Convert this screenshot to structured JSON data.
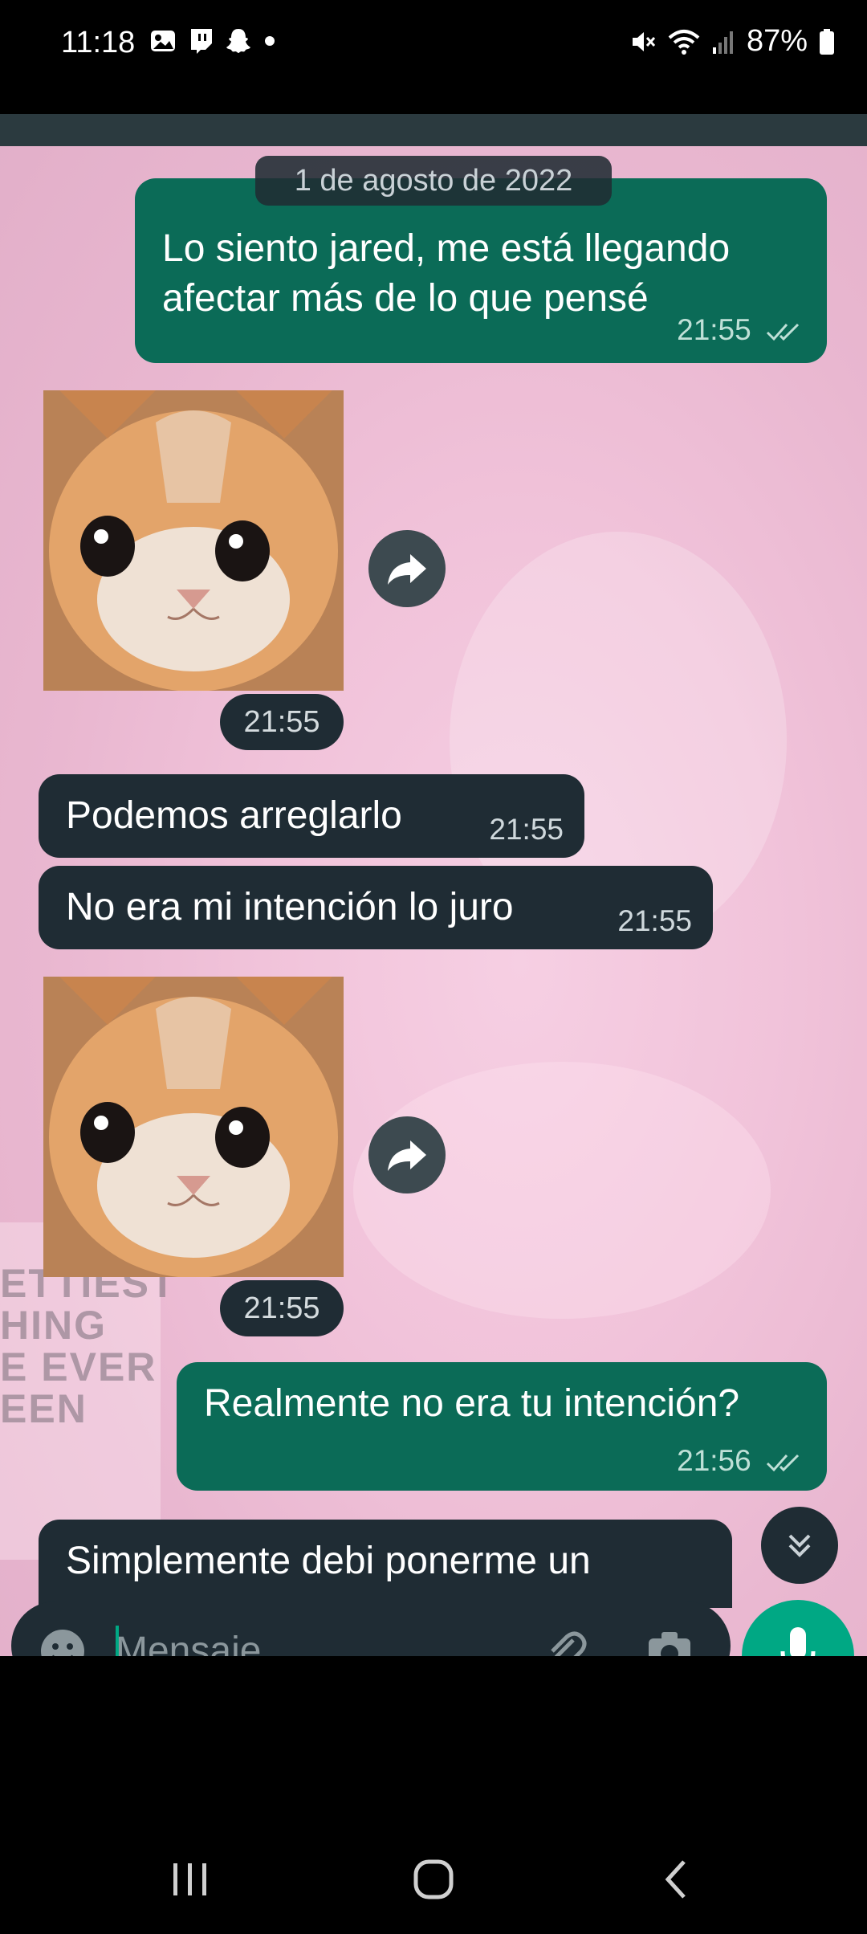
{
  "status_bar": {
    "time": "11:18",
    "battery": "87%",
    "left_icons": [
      "gallery-icon",
      "twitch-icon",
      "snapchat-icon",
      "dot-icon"
    ],
    "right_icons": [
      "mute-icon",
      "wifi-icon",
      "signal-icon",
      "battery-icon"
    ]
  },
  "chat": {
    "date_chip": "1 de agosto de 2022",
    "messages": [
      {
        "direction": "outgoing",
        "text_line1": "Lo siento jared, me está llegando",
        "text_line2": "afectar más de lo que pensé",
        "time": "21:55",
        "status": "read"
      },
      {
        "direction": "incoming",
        "type": "image",
        "alt": "crying kitten",
        "time": "21:55"
      },
      {
        "direction": "incoming",
        "text": "Podemos arreglarlo",
        "time": "21:55"
      },
      {
        "direction": "incoming",
        "text": "No era mi intención lo juro",
        "time": "21:55"
      },
      {
        "direction": "incoming",
        "type": "image",
        "alt": "crying kitten",
        "time": "21:55"
      },
      {
        "direction": "outgoing",
        "text": "Realmente no era tu intención?",
        "time": "21:56",
        "status": "read"
      },
      {
        "direction": "incoming",
        "text": "Simplemente debi ponerme un",
        "time": ""
      }
    ],
    "background_text": [
      "ETTIEST",
      "HING",
      "E EVER",
      "EEN"
    ]
  },
  "composer": {
    "placeholder": "Mensaje",
    "icons": [
      "emoji-icon",
      "attach-icon",
      "camera-icon",
      "mic-icon"
    ]
  },
  "nav_bar": {
    "buttons": [
      "recents-button",
      "home-button",
      "back-button"
    ]
  },
  "colors": {
    "outgoing_bubble": "#0b6b57",
    "incoming_bubble": "#1f2c34",
    "accent": "#00a884"
  }
}
